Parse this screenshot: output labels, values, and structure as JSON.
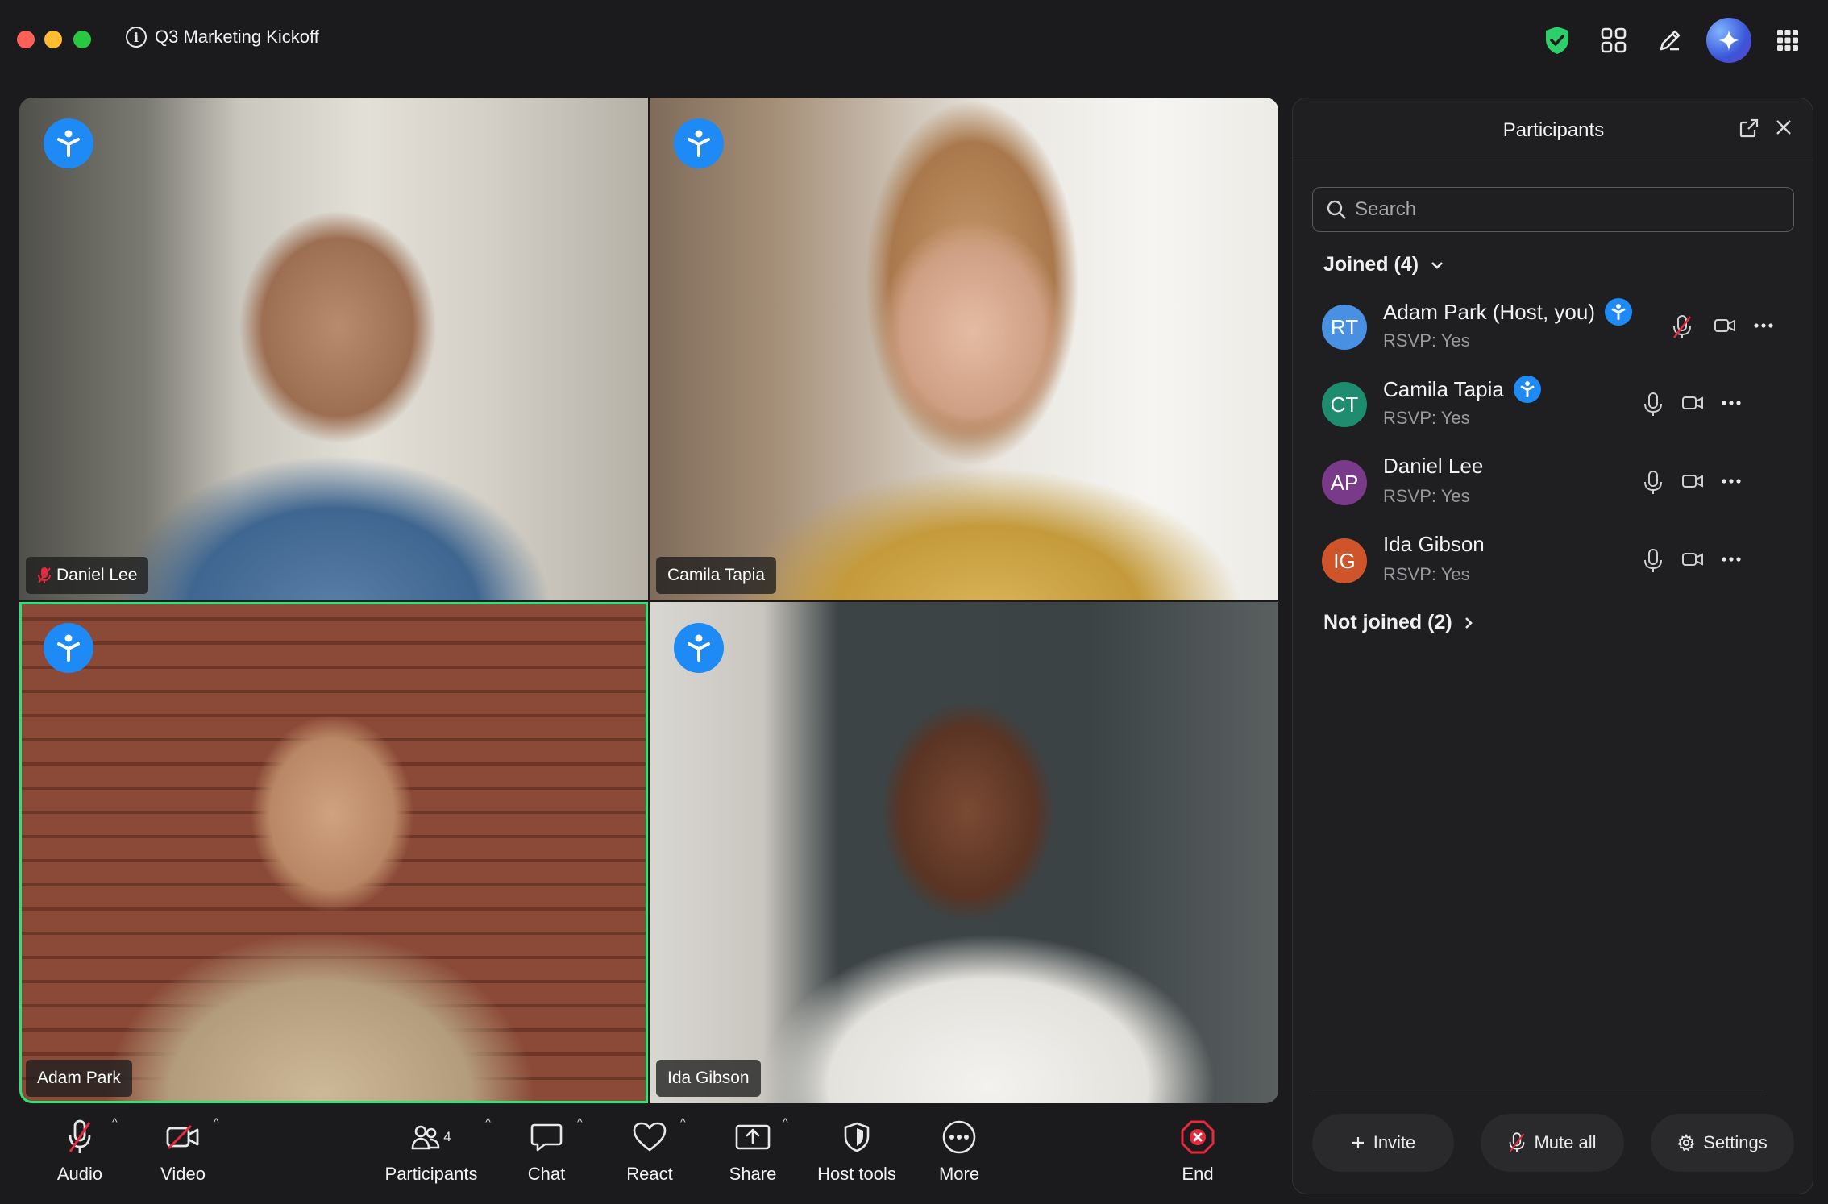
{
  "meeting": {
    "title": "Q3 Marketing Kickoff"
  },
  "tiles": [
    {
      "name": "Daniel Lee",
      "muted": true
    },
    {
      "name": "Camila Tapia",
      "muted": false
    },
    {
      "name": "Adam Park",
      "muted": false,
      "active_speaker": true
    },
    {
      "name": "Ida Gibson",
      "muted": false
    }
  ],
  "controls": {
    "audio": "Audio",
    "video": "Video",
    "participants": "Participants",
    "participants_count": "4",
    "chat": "Chat",
    "react": "React",
    "share": "Share",
    "host_tools": "Host tools",
    "more": "More",
    "end": "End"
  },
  "panel": {
    "title": "Participants",
    "search_placeholder": "Search",
    "joined_label": "Joined (4)",
    "not_joined_label": "Not joined (2)",
    "participants": [
      {
        "initials": "RT",
        "name": "Adam Park (Host, you)",
        "rsvp": "RSVP: Yes",
        "avatar_color": "#4a90e2",
        "muted": true,
        "badge": true
      },
      {
        "initials": "CT",
        "name": "Camila Tapia",
        "rsvp": "RSVP: Yes",
        "avatar_color": "#1e8c6e",
        "muted": false,
        "badge": true
      },
      {
        "initials": "AP",
        "name": "Daniel Lee",
        "rsvp": "RSVP: Yes",
        "avatar_color": "#7a3a8a",
        "muted": false,
        "badge": false
      },
      {
        "initials": "IG",
        "name": "Ida Gibson",
        "rsvp": "RSVP: Yes",
        "avatar_color": "#d0542a",
        "muted": false,
        "badge": false
      }
    ],
    "invite": "Invite",
    "mute_all": "Mute all",
    "settings": "Settings"
  },
  "colors": {
    "accent_blue": "#1d8af5",
    "active_border": "#2ee27a",
    "end_red": "#e8283c",
    "shield_green": "#2ecf6a"
  }
}
